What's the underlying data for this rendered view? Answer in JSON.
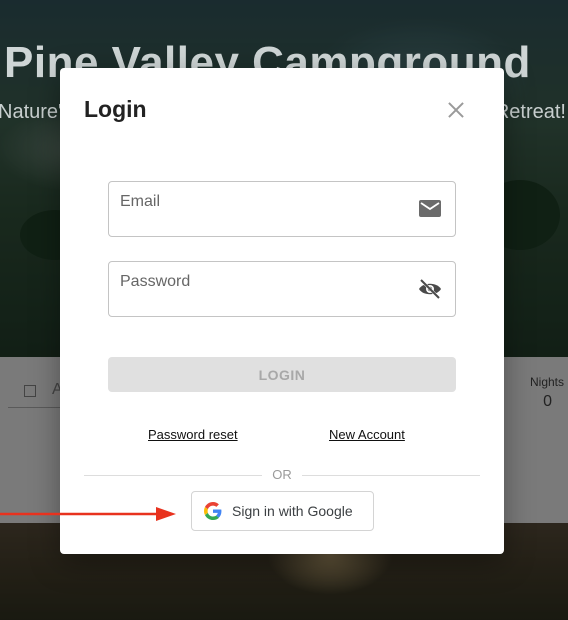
{
  "hero": {
    "title": "Pine Valley Campground",
    "subtitle_left": "Nature'",
    "subtitle_right": "Retreat!"
  },
  "booking": {
    "input_partial_text": "A",
    "nights_label": "Nights",
    "nights_value": "0"
  },
  "modal": {
    "title": "Login",
    "email_label": "Email",
    "password_label": "Password",
    "login_button": "LOGIN",
    "password_reset": "Password reset",
    "new_account": "New Account",
    "or": "OR",
    "google_button": "Sign in with Google",
    "icons": {
      "close": "close-icon",
      "email": "mail-icon",
      "password": "visibility-off-icon",
      "google": "google-g-icon"
    }
  },
  "annotation": {
    "arrow_color": "#e8321e"
  }
}
